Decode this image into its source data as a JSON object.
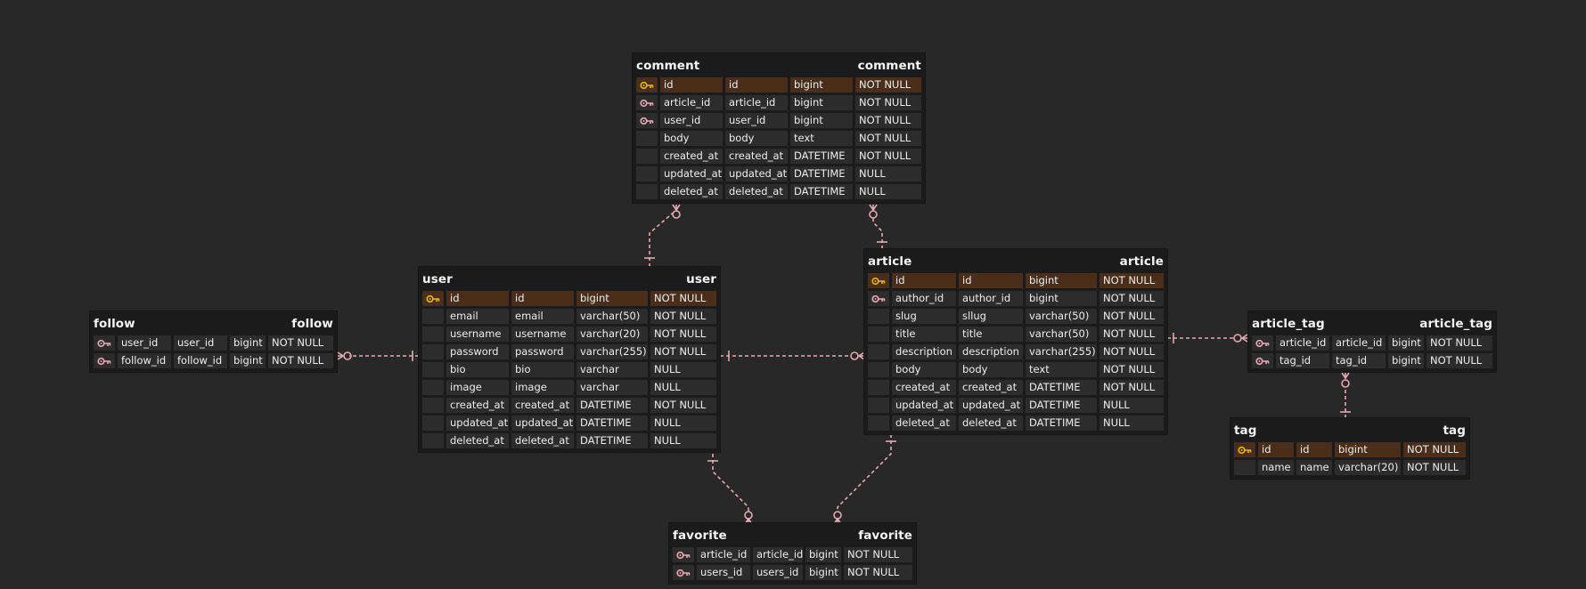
{
  "colors": {
    "background": "#282828",
    "table_bg": "#1b1b1b",
    "cell_bg": "#2c2c2c",
    "pk_row_bg": "#4a2e1a",
    "pk_key": "#e6b800",
    "fk_key": "#e8a8b8",
    "relation_line": "#e3a9b5"
  },
  "tables": {
    "comment": {
      "title_left": "comment",
      "title_right": "comment",
      "columns": [
        {
          "key": "pk",
          "name": "id",
          "logical": "id",
          "type": "bigint",
          "null": "NOT NULL"
        },
        {
          "key": "fk",
          "name": "article_id",
          "logical": "article_id",
          "type": "bigint",
          "null": "NOT NULL"
        },
        {
          "key": "fk",
          "name": "user_id",
          "logical": "user_id",
          "type": "bigint",
          "null": "NOT NULL"
        },
        {
          "key": "",
          "name": "body",
          "logical": "body",
          "type": "text",
          "null": "NOT NULL"
        },
        {
          "key": "",
          "name": "created_at",
          "logical": "created_at",
          "type": "DATETIME",
          "null": "NOT NULL"
        },
        {
          "key": "",
          "name": "updated_at",
          "logical": "updated_at",
          "type": "DATETIME",
          "null": "NULL"
        },
        {
          "key": "",
          "name": "deleted_at",
          "logical": "deleted_at",
          "type": "DATETIME",
          "null": "NULL"
        }
      ]
    },
    "user": {
      "title_left": "user",
      "title_right": "user",
      "columns": [
        {
          "key": "pk",
          "name": "id",
          "logical": "id",
          "type": "bigint",
          "null": "NOT NULL"
        },
        {
          "key": "",
          "name": "email",
          "logical": "email",
          "type": "varchar(50)",
          "null": "NOT NULL"
        },
        {
          "key": "",
          "name": "username",
          "logical": "username",
          "type": "varchar(20)",
          "null": "NOT NULL"
        },
        {
          "key": "",
          "name": "password",
          "logical": "password",
          "type": "varchar(255)",
          "null": "NOT NULL"
        },
        {
          "key": "",
          "name": "bio",
          "logical": "bio",
          "type": "varchar",
          "null": "NULL"
        },
        {
          "key": "",
          "name": "image",
          "logical": "image",
          "type": "varchar",
          "null": "NULL"
        },
        {
          "key": "",
          "name": "created_at",
          "logical": "created_at",
          "type": "DATETIME",
          "null": "NOT NULL"
        },
        {
          "key": "",
          "name": "updated_at",
          "logical": "updated_at",
          "type": "DATETIME",
          "null": "NULL"
        },
        {
          "key": "",
          "name": "deleted_at",
          "logical": "deleted_at",
          "type": "DATETIME",
          "null": "NULL"
        }
      ]
    },
    "article": {
      "title_left": "article",
      "title_right": "article",
      "columns": [
        {
          "key": "pk",
          "name": "id",
          "logical": "id",
          "type": "bigint",
          "null": "NOT NULL"
        },
        {
          "key": "fk",
          "name": "author_id",
          "logical": "author_id",
          "type": "bigint",
          "null": "NOT NULL"
        },
        {
          "key": "",
          "name": "slug",
          "logical": "sllug",
          "type": "varchar(50)",
          "null": "NOT NULL"
        },
        {
          "key": "",
          "name": "title",
          "logical": "title",
          "type": "varchar(50)",
          "null": "NOT NULL"
        },
        {
          "key": "",
          "name": "description",
          "logical": "description",
          "type": "varchar(255)",
          "null": "NOT NULL"
        },
        {
          "key": "",
          "name": "body",
          "logical": "body",
          "type": "text",
          "null": "NOT NULL"
        },
        {
          "key": "",
          "name": "created_at",
          "logical": "created_at",
          "type": "DATETIME",
          "null": "NOT NULL"
        },
        {
          "key": "",
          "name": "updated_at",
          "logical": "updated_at",
          "type": "DATETIME",
          "null": "NULL"
        },
        {
          "key": "",
          "name": "deleted_at",
          "logical": "deleted_at",
          "type": "DATETIME",
          "null": "NULL"
        }
      ]
    },
    "follow": {
      "title_left": "follow",
      "title_right": "follow",
      "columns": [
        {
          "key": "fk",
          "name": "user_id",
          "logical": "user_id",
          "type": "bigint",
          "null": "NOT NULL"
        },
        {
          "key": "fk",
          "name": "follow_id",
          "logical": "follow_id",
          "type": "bigint",
          "null": "NOT NULL"
        }
      ]
    },
    "article_tag": {
      "title_left": "article_tag",
      "title_right": "article_tag",
      "columns": [
        {
          "key": "fk",
          "name": "article_id",
          "logical": "article_id",
          "type": "bigint",
          "null": "NOT NULL"
        },
        {
          "key": "fk",
          "name": "tag_id",
          "logical": "tag_id",
          "type": "bigint",
          "null": "NOT NULL"
        }
      ]
    },
    "tag": {
      "title_left": "tag",
      "title_right": "tag",
      "columns": [
        {
          "key": "pk",
          "name": "id",
          "logical": "id",
          "type": "bigint",
          "null": "NOT NULL"
        },
        {
          "key": "",
          "name": "name",
          "logical": "name",
          "type": "varchar(20)",
          "null": "NOT NULL"
        }
      ]
    },
    "favorite": {
      "title_left": "favorite",
      "title_right": "favorite",
      "columns": [
        {
          "key": "fk",
          "name": "article_id",
          "logical": "article_id",
          "type": "bigint",
          "null": "NOT NULL"
        },
        {
          "key": "fk",
          "name": "users_id",
          "logical": "users_id",
          "type": "bigint",
          "null": "NOT NULL"
        }
      ]
    }
  },
  "relations": [
    {
      "from": "user",
      "to": "comment",
      "from_cardinality": "one",
      "to_cardinality": "zero-or-many"
    },
    {
      "from": "article",
      "to": "comment",
      "from_cardinality": "one",
      "to_cardinality": "zero-or-many"
    },
    {
      "from": "user",
      "to": "follow",
      "from_cardinality": "one",
      "to_cardinality": "zero-or-many"
    },
    {
      "from": "user",
      "to": "article",
      "from_cardinality": "one",
      "to_cardinality": "zero-or-many"
    },
    {
      "from": "article",
      "to": "article_tag",
      "from_cardinality": "one",
      "to_cardinality": "zero-or-many"
    },
    {
      "from": "tag",
      "to": "article_tag",
      "from_cardinality": "one",
      "to_cardinality": "zero-or-many"
    },
    {
      "from": "user",
      "to": "favorite",
      "from_cardinality": "one",
      "to_cardinality": "zero-or-many"
    },
    {
      "from": "article",
      "to": "favorite",
      "from_cardinality": "one",
      "to_cardinality": "zero-or-many"
    }
  ]
}
